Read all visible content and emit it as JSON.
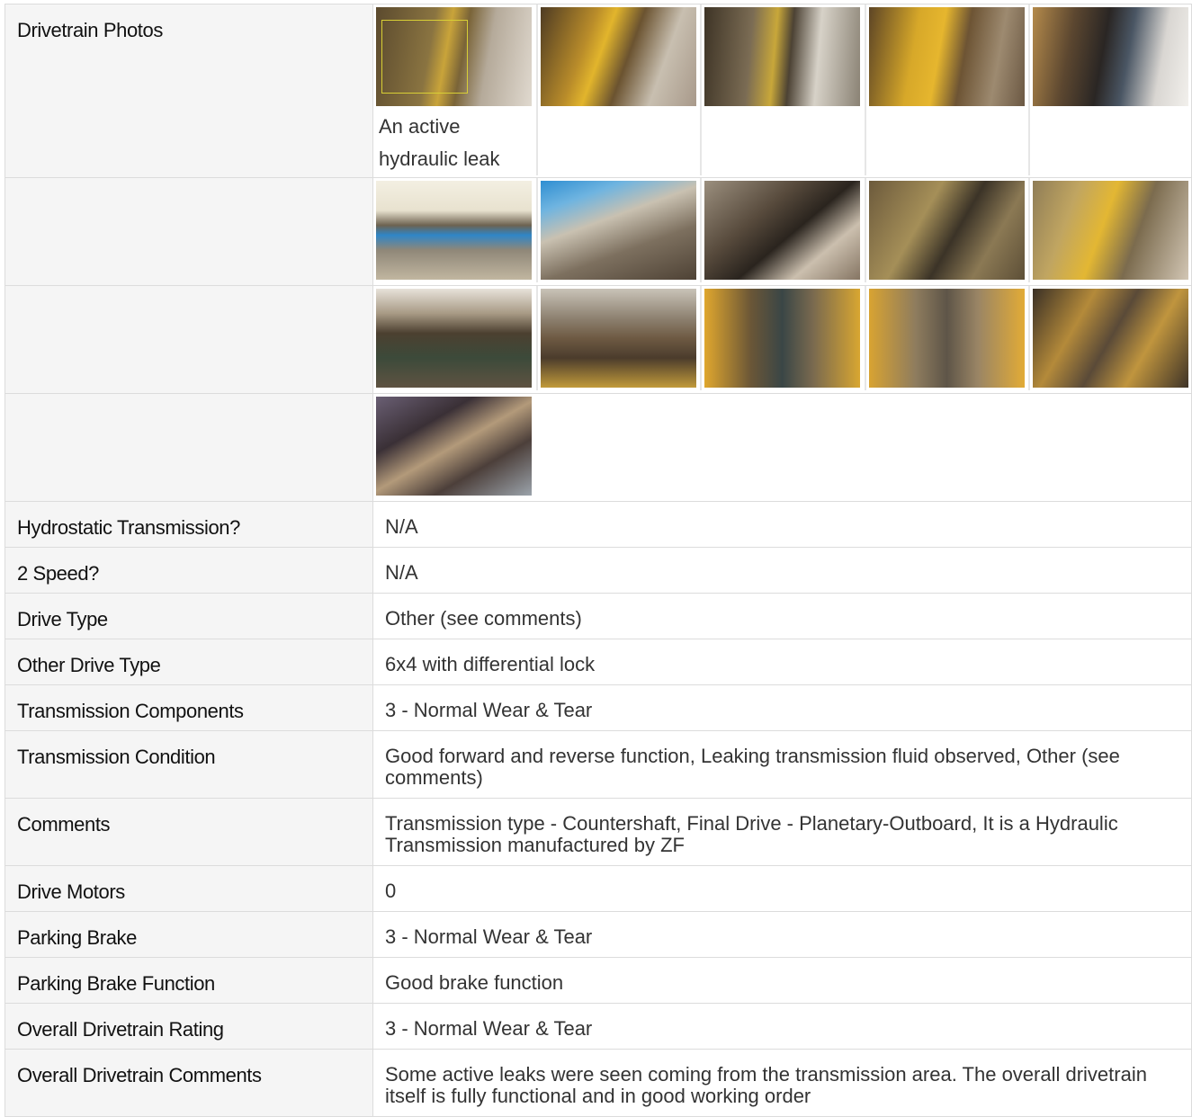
{
  "photos_section": {
    "label": "Drivetrain Photos",
    "first_caption": "An active hydraulic leak",
    "rows": [
      [
        "p1",
        "p2",
        "p3",
        "p4",
        "p5"
      ],
      [
        "p6",
        "p7",
        "p8",
        "p9",
        "p10"
      ],
      [
        "p11",
        "p12",
        "p13",
        "p14",
        "p15"
      ],
      [
        "p16"
      ]
    ]
  },
  "fields": [
    {
      "label": "Hydrostatic Transmission?",
      "value": "N/A"
    },
    {
      "label": "2 Speed?",
      "value": "N/A"
    },
    {
      "label": "Drive Type",
      "value": "Other (see comments)"
    },
    {
      "label": "Other Drive Type",
      "value": "6x4 with differential lock"
    },
    {
      "label": "Transmission Components",
      "value": "3 - Normal Wear & Tear"
    },
    {
      "label": "Transmission Condition",
      "value": "Good forward and reverse function, Leaking transmission fluid observed, Other (see comments)"
    },
    {
      "label": "Comments",
      "value": "Transmission type - Countershaft, Final Drive - Planetary-Outboard, It is a Hydraulic Transmission manufactured by ZF"
    },
    {
      "label": "Drive Motors",
      "value": "0"
    },
    {
      "label": "Parking Brake",
      "value": "3 - Normal Wear & Tear"
    },
    {
      "label": "Parking Brake Function",
      "value": "Good brake function"
    },
    {
      "label": "Overall Drivetrain Rating",
      "value": "3 - Normal Wear & Tear"
    },
    {
      "label": "Overall Drivetrain Comments",
      "value": "Some active leaks were seen coming from the transmission area. The overall drivetrain itself is fully functional and in good working order"
    }
  ]
}
